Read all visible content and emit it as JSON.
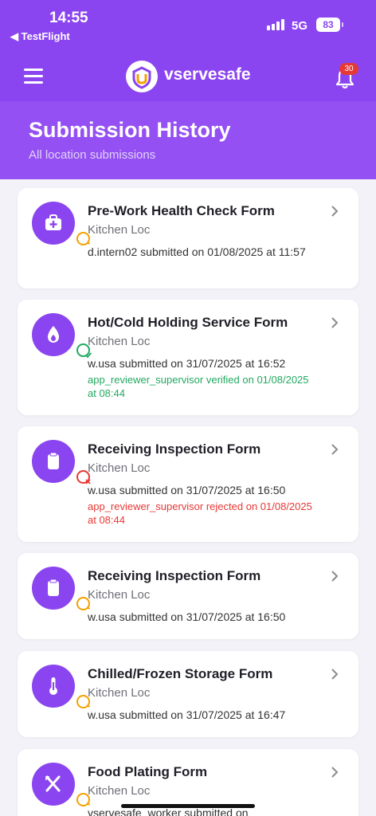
{
  "status_bar": {
    "time": "14:55",
    "back_app": "◀ TestFlight",
    "network": "5G",
    "battery": "83"
  },
  "app_bar": {
    "brand": "vservesafe",
    "notification_count": "30",
    "accent": "#8b45f0"
  },
  "page": {
    "title": "Submission History",
    "subtitle": "All location submissions"
  },
  "submissions": [
    {
      "title": "Pre-Work Health Check Form",
      "location": "Kitchen Loc",
      "submitted": "d.intern02 submitted on 01/08/2025 at 11:57",
      "status": "pending",
      "icon": "first-aid-kit-icon"
    },
    {
      "title": "Hot/Cold Holding Service Form",
      "location": "Kitchen Loc",
      "submitted": "w.usa submitted on 31/07/2025 at 16:52",
      "status": "verified",
      "status_note": "app_reviewer_supervisor verified on 01/08/2025 at 08:44",
      "icon": "flame-icon"
    },
    {
      "title": "Receiving Inspection Form",
      "location": "Kitchen Loc",
      "submitted": "w.usa submitted on 31/07/2025 at 16:50",
      "status": "rejected",
      "status_note": "app_reviewer_supervisor rejected on 01/08/2025 at 08:44",
      "icon": "clipboard-icon"
    },
    {
      "title": "Receiving Inspection Form",
      "location": "Kitchen Loc",
      "submitted": "w.usa submitted on 31/07/2025 at 16:50",
      "status": "pending",
      "icon": "clipboard-icon"
    },
    {
      "title": "Chilled/Frozen Storage Form",
      "location": "Kitchen Loc",
      "submitted": "w.usa submitted on 31/07/2025 at 16:47",
      "status": "pending",
      "icon": "thermometer-icon"
    },
    {
      "title": "Food Plating Form",
      "location": "Kitchen Loc",
      "submitted": "vservesafe_worker submitted on",
      "status": "pending",
      "icon": "fork-knife-icon"
    }
  ],
  "status_colors": {
    "pending": "#f4a100",
    "verified": "#21a960",
    "rejected": "#e53935"
  }
}
